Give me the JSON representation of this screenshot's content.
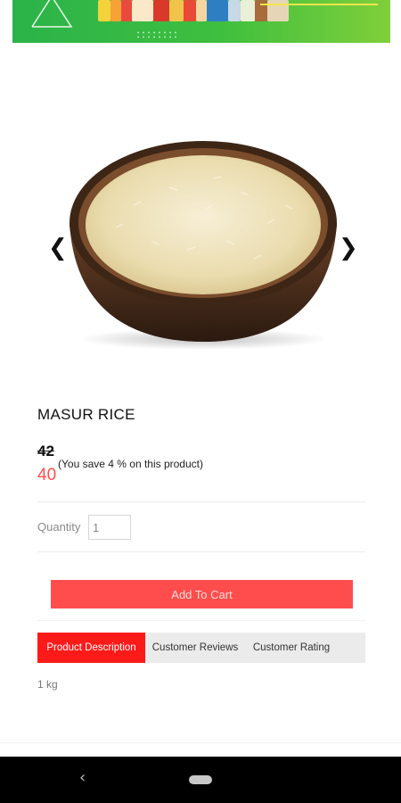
{
  "product": {
    "title": "MASUR RICE",
    "old_price": "42",
    "new_price": "40",
    "saving_text": "(You save 4 % on this product)"
  },
  "gallery": {
    "prev_icon": "chevron-left-icon",
    "next_icon": "chevron-right-icon",
    "prev_glyph": "❮",
    "next_glyph": "❯"
  },
  "quantity": {
    "label": "Quantity",
    "value": "1"
  },
  "actions": {
    "add_to_cart": "Add To Cart"
  },
  "tabs": [
    {
      "label": "Product Description",
      "active": true
    },
    {
      "label": "Customer Reviews",
      "active": false
    },
    {
      "label": "Customer Rating",
      "active": false
    }
  ],
  "description": {
    "text": "1 kg"
  },
  "system_nav": {
    "back_glyph": "‹"
  },
  "colors": {
    "accent": "#ff4d4d",
    "tab_active": "#ff1a1a",
    "banner_green": "#2bb34a"
  }
}
